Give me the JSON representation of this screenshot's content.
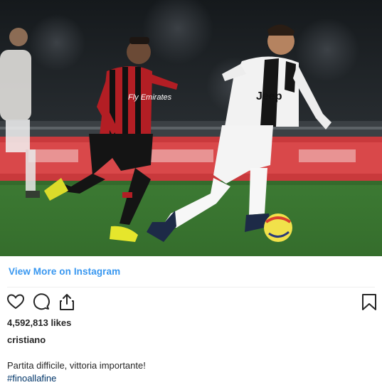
{
  "post": {
    "image_alt": "Juventus vs AC Milan football match",
    "view_more_label": "View More on Instagram",
    "likes": "4,592,813 likes",
    "username": "cristiano",
    "caption": "Partita difficile, vittoria importante!",
    "hashtag": "#finoallafine"
  },
  "photo_text": {
    "jersey_sponsor_juve": "Jeep",
    "jersey_sponsor_milan": "Fly Emirates"
  },
  "icons": {
    "like": "heart-icon",
    "comment": "comment-icon",
    "share": "share-icon",
    "save": "bookmark-icon"
  },
  "colors": {
    "link_blue": "#3897f0",
    "hashtag_blue": "#003569",
    "text": "#262626",
    "pitch_green": "#3e7a35",
    "milan_red": "#b31e24"
  }
}
